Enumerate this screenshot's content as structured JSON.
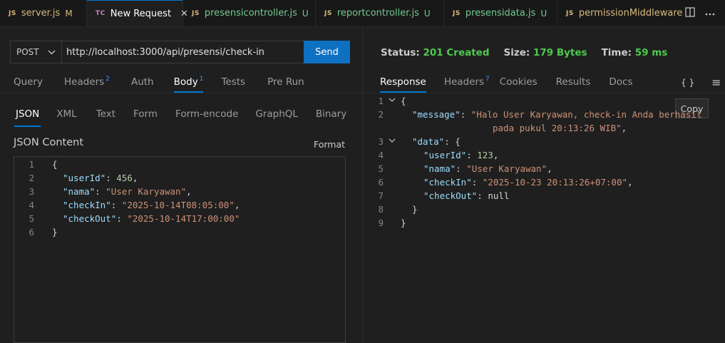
{
  "tabs": [
    {
      "icon": "JS",
      "label": "server.js",
      "status": "M"
    },
    {
      "icon": "TC",
      "label": "New Request",
      "status": ""
    },
    {
      "icon": "JS",
      "label": "presensicontroller.js",
      "status": "U"
    },
    {
      "icon": "JS",
      "label": "reportcontroller.js",
      "status": "U"
    },
    {
      "icon": "JS",
      "label": "presensidata.js",
      "status": "U"
    },
    {
      "icon": "JS",
      "label": "permissionMiddleware.js",
      "status": ""
    }
  ],
  "request": {
    "method": "POST",
    "url": "http://localhost:3000/api/presensi/check-in",
    "send_label": "Send"
  },
  "request_tabs": [
    {
      "label": "Query",
      "count": ""
    },
    {
      "label": "Headers",
      "count": "2"
    },
    {
      "label": "Auth",
      "count": ""
    },
    {
      "label": "Body",
      "count": "1"
    },
    {
      "label": "Tests",
      "count": ""
    },
    {
      "label": "Pre Run",
      "count": ""
    }
  ],
  "body_types": [
    "JSON",
    "XML",
    "Text",
    "Form",
    "Form-encode",
    "GraphQL",
    "Binary"
  ],
  "json_content_label": "JSON Content",
  "format_label": "Format",
  "request_body": {
    "line_numbers": [
      "1",
      "2",
      "3",
      "4",
      "5",
      "6"
    ],
    "userId_key": "\"userId\"",
    "userId_val": "456",
    "nama_key": "\"nama\"",
    "nama_val": "\"User Karyawan\"",
    "checkIn_key": "\"checkIn\"",
    "checkIn_val": "\"2025-10-14T08:05:00\"",
    "checkOut_key": "\"checkOut\"",
    "checkOut_val": "\"2025-10-14T17:00:00\""
  },
  "status_bar": {
    "status_label": "Status:",
    "status_value": "201 Created",
    "size_label": "Size:",
    "size_value": "179 Bytes",
    "time_label": "Time:",
    "time_value": "59 ms"
  },
  "response_tabs": [
    {
      "label": "Response",
      "count": ""
    },
    {
      "label": "Headers",
      "count": "7"
    },
    {
      "label": "Cookies",
      "count": ""
    },
    {
      "label": "Results",
      "count": ""
    },
    {
      "label": "Docs",
      "count": ""
    }
  ],
  "response_icons": {
    "braces": "{ }",
    "menu": "≡"
  },
  "copy_label": "Copy",
  "response_body": {
    "line_numbers": [
      "1",
      "2",
      "",
      "3",
      "4",
      "5",
      "6",
      "7",
      "8",
      "9"
    ],
    "message_key": "\"message\"",
    "message_val_1": "\"Halo User Karyawan, check-in Anda berhasil",
    "message_val_2": "pada pukul 20:13:26 WIB\"",
    "data_key": "\"data\"",
    "userId_key": "\"userId\"",
    "userId_val": "123",
    "nama_key": "\"nama\"",
    "nama_val": "\"User Karyawan\"",
    "checkIn_key": "\"checkIn\"",
    "checkIn_val": "\"2025-10-23 20:13:26+07:00\"",
    "checkOut_key": "\"checkOut\"",
    "checkOut_val": "null"
  },
  "colors": {
    "accent": "#0078d4",
    "send_button": "#0e70c0",
    "status_ok": "#4ec94e",
    "json_key": "#9cdcfe",
    "json_string": "#ce9178",
    "json_number": "#b5cea8"
  }
}
